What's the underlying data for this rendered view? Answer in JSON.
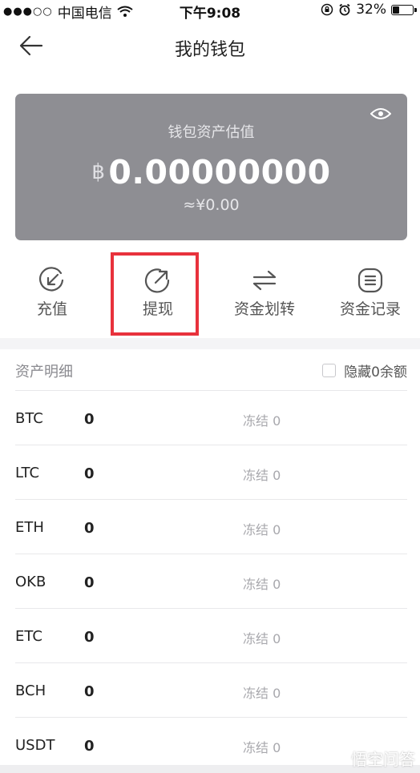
{
  "status_bar": {
    "signal": "●●●○○",
    "carrier": "中国电信",
    "time": "下午9:08",
    "battery": "32%",
    "battery_level": 0.32
  },
  "nav": {
    "title": "我的钱包"
  },
  "wallet_card": {
    "label": "钱包资产估值",
    "currency_symbol": "฿",
    "balance": "0.00000000",
    "fiat_value": "≈¥0.00",
    "bg_color": "#8e8e93"
  },
  "actions": [
    {
      "label": "充值",
      "icon": "deposit-icon"
    },
    {
      "label": "提现",
      "icon": "withdraw-icon"
    },
    {
      "label": "资金划转",
      "icon": "transfer-icon"
    },
    {
      "label": "资金记录",
      "icon": "records-icon"
    }
  ],
  "highlight_color": "#e8323c",
  "assets": {
    "title": "资产明细",
    "hide_zero_label": "隐藏0余额",
    "rows": [
      {
        "symbol": "BTC",
        "balance": "0",
        "frozen": "冻结 0"
      },
      {
        "symbol": "LTC",
        "balance": "0",
        "frozen": "冻结 0"
      },
      {
        "symbol": "ETH",
        "balance": "0",
        "frozen": "冻结 0"
      },
      {
        "symbol": "OKB",
        "balance": "0",
        "frozen": "冻结 0"
      },
      {
        "symbol": "ETC",
        "balance": "0",
        "frozen": "冻结 0"
      },
      {
        "symbol": "BCH",
        "balance": "0",
        "frozen": "冻结 0"
      },
      {
        "symbol": "USDT",
        "balance": "0",
        "frozen": "冻结 0"
      }
    ]
  },
  "watermark": "悟空问答"
}
